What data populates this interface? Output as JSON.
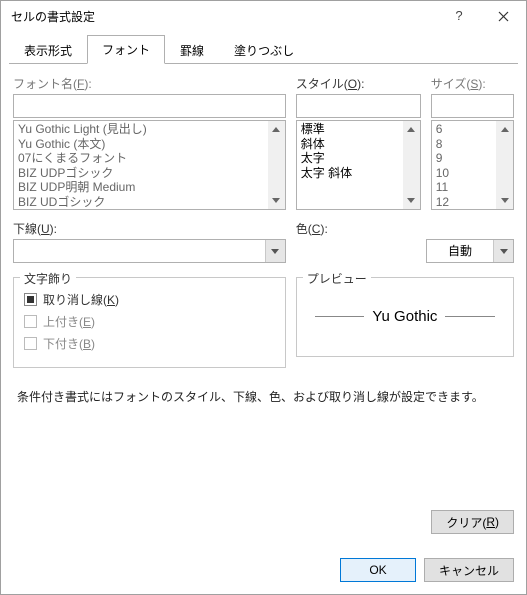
{
  "window": {
    "title": "セルの書式設定"
  },
  "tabs": {
    "display": "表示形式",
    "font": "フォント",
    "border": "罫線",
    "fill": "塗りつぶし"
  },
  "labels": {
    "fontName": "フォント名(<span class='u'>F</span>):",
    "style": "スタイル(<span class='u'>O</span>):",
    "size": "サイズ(<span class='u'>S</span>):",
    "underline": "下線(<span class='u'>U</span>):",
    "color": "色(<span class='u'>C</span>):",
    "effects": "文字飾り",
    "preview": "プレビュー",
    "strike": "取り消し線(<span class='u'>K</span>)",
    "super": "上付き(<span class='u'>E</span>)",
    "sub": "下付き(<span class='u'>B</span>)"
  },
  "fontList": [
    "Yu Gothic Light (見出し)",
    "Yu Gothic (本文)",
    "07にくまるフォント",
    "BIZ UDPゴシック",
    "BIZ UDP明朝 Medium",
    "BIZ UDゴシック"
  ],
  "styleList": [
    "標準",
    "斜体",
    "太字",
    "太字 斜体"
  ],
  "sizeList": [
    "6",
    "8",
    "9",
    "10",
    "11",
    "12"
  ],
  "colorValue": "自動",
  "previewText": "Yu Gothic",
  "note": "条件付き書式にはフォントのスタイル、下線、色、および取り消し線が設定できます。",
  "buttons": {
    "clear": "クリア(<span class='u'>R</span>)",
    "ok": "OK",
    "cancel": "キャンセル"
  }
}
